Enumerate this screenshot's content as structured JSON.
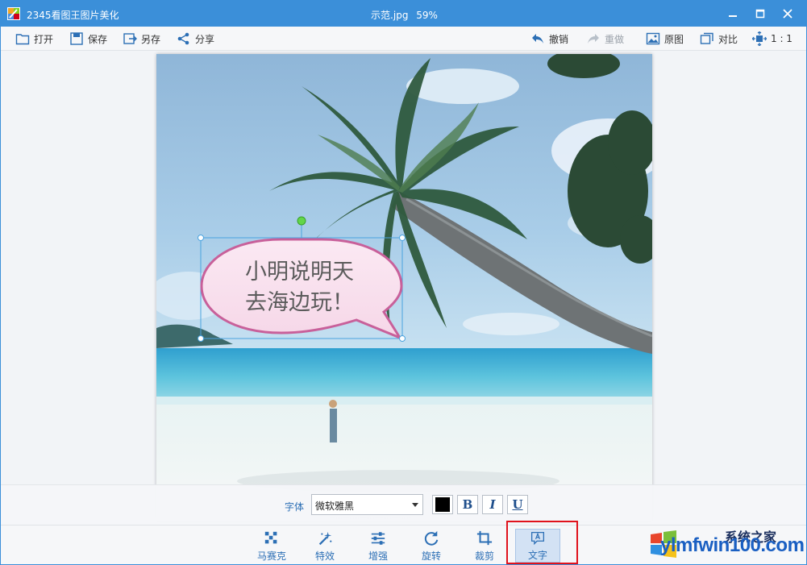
{
  "titlebar": {
    "app_title": "2345看图王图片美化",
    "file_name": "示范.jpg",
    "zoom": "59%"
  },
  "toolbar": {
    "open": "打开",
    "save": "保存",
    "save_as": "另存",
    "share": "分享",
    "undo": "撤销",
    "redo": "重做",
    "original": "原图",
    "compare": "对比",
    "actual_size": "1 : 1"
  },
  "speech_bubble": {
    "line1": "小明说明天",
    "line2": "去海边玩！"
  },
  "text_panel": {
    "font_label": "字体",
    "font_value": "微软雅黑",
    "bold": "B",
    "italic": "I",
    "underline": "U",
    "text_color": "#000000"
  },
  "tools": {
    "mosaic": "马赛克",
    "effects": "特效",
    "enhance": "增强",
    "rotate": "旋转",
    "crop": "裁剪",
    "text": "文字"
  },
  "watermark": {
    "url": "ylmfwin100.com",
    "title": "系统之家"
  },
  "colors": {
    "titlebar": "#3b8fd9",
    "accent_text": "#2c6fb5",
    "highlight": "#e0121c",
    "bubble_border": "#c8609a"
  }
}
